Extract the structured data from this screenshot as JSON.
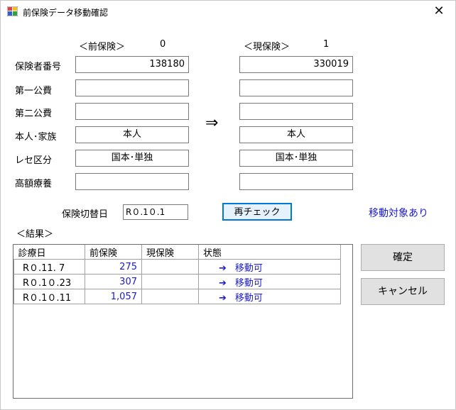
{
  "window": {
    "title": "前保険データ移動確認",
    "close_glyph": "✕"
  },
  "previous": {
    "header": "＜前保険＞",
    "count": "0"
  },
  "current": {
    "header": "＜現保険＞",
    "count": "1"
  },
  "labels": {
    "insurer_number": "保険者番号",
    "public1": "第一公費",
    "public2": "第二公費",
    "person_family": "本人･家族",
    "receipt_class": "レセ区分",
    "high_cost": "高額療養"
  },
  "previous_fields": {
    "insurer_number": "138180",
    "public1": "",
    "public2": "",
    "person_family": "本人",
    "receipt_class": "国本･単独",
    "high_cost": ""
  },
  "current_fields": {
    "insurer_number": "330019",
    "public1": "",
    "public2": "",
    "person_family": "本人",
    "receipt_class": "国本･単独",
    "high_cost": ""
  },
  "transfer_arrow": "⇒",
  "switch_date": {
    "label": "保険切替日",
    "value": "R０.1０.1"
  },
  "recheck_label": "再チェック",
  "move_status": "移動対象あり",
  "results_label": "＜結果＞",
  "grid": {
    "columns": [
      "診療日",
      "前保険",
      "現保険",
      "状態"
    ],
    "rows": [
      {
        "date": "R０.11. 7",
        "prev": "275",
        "curr": "",
        "status": "移動可"
      },
      {
        "date": "R０.1０.23",
        "prev": "307",
        "curr": "",
        "status": "移動可"
      },
      {
        "date": "R０.1０.11",
        "prev": "1,057",
        "curr": "",
        "status": "移動可"
      }
    ],
    "status_arrow": "➔"
  },
  "buttons": {
    "confirm": "確定",
    "cancel": "キャンセル"
  },
  "colors": {
    "link_blue": "#1a1ad0",
    "button_face": "#e1e1e1"
  }
}
